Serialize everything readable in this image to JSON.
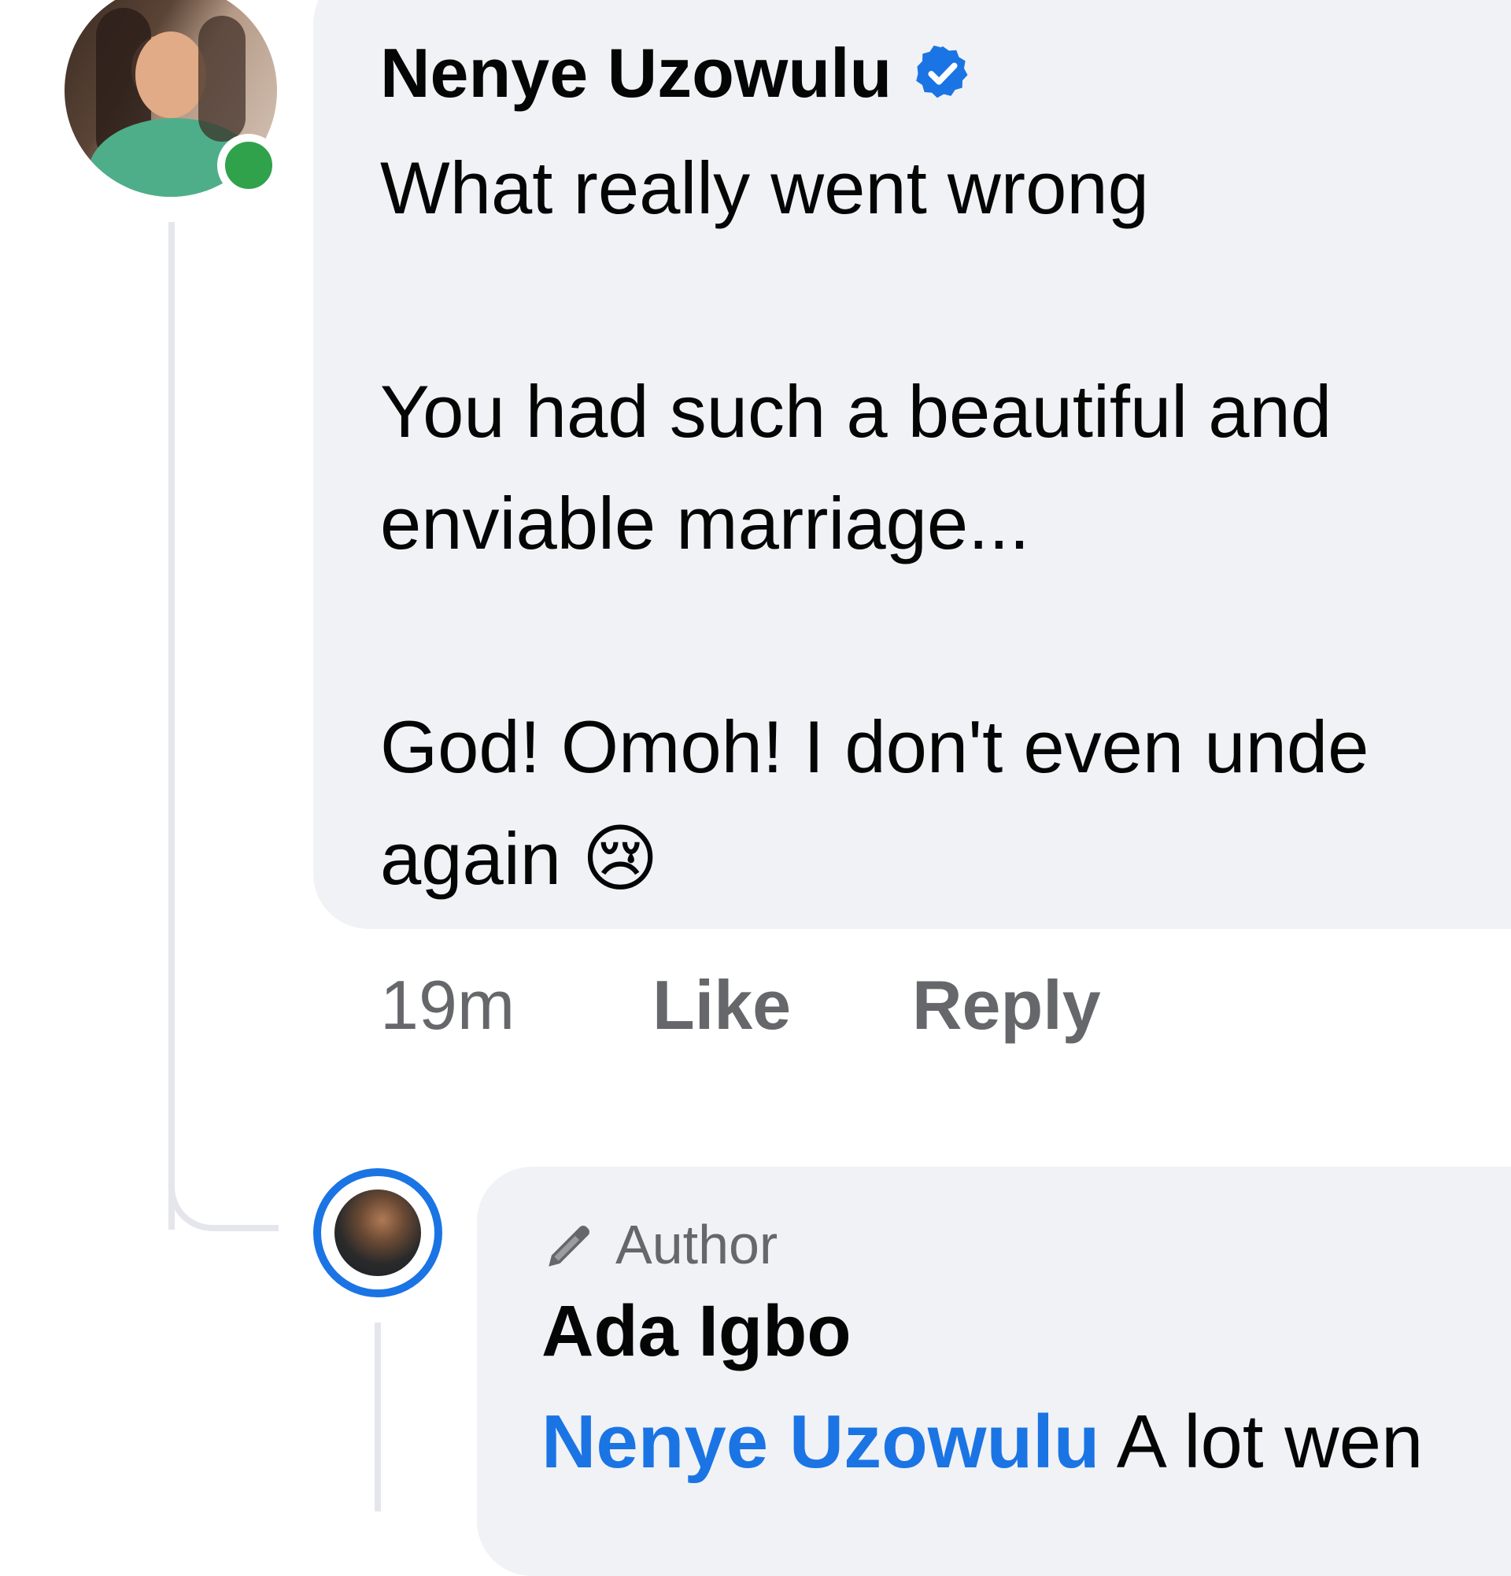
{
  "comment": {
    "author": "Nenye Uzowulu",
    "verified_icon": "verified-badge-icon",
    "text": "What really went wrong\n\nYou had such a beautiful and\nenviable marriage...\n\nGod! Omoh! I don't even unde\nagain 😢",
    "time": "19m",
    "like_label": "Like",
    "reply_label": "Reply",
    "online_color": "#31a24c"
  },
  "reply": {
    "badge_label": "Author",
    "badge_icon": "pencil-icon",
    "author": "Ada Igbo",
    "mention": "Nenye Uzowulu",
    "text": " A lot wen"
  },
  "colors": {
    "bubble": "#f0f2f5",
    "accent": "#1b74e4",
    "muted": "#65676b"
  }
}
